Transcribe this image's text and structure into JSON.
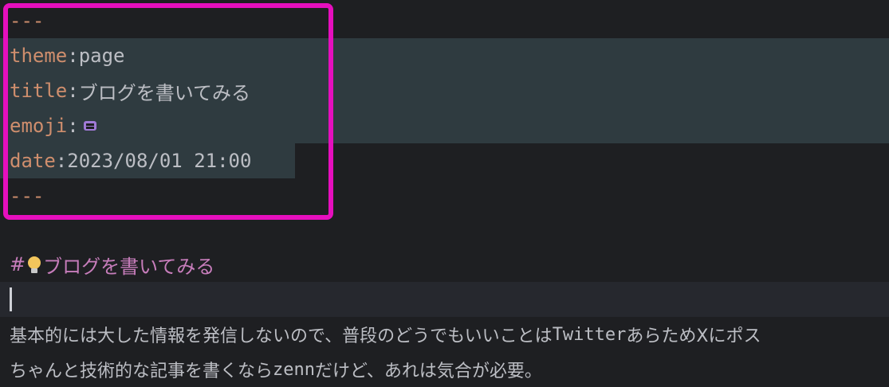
{
  "frontmatter": {
    "open_delim": "---",
    "theme_key": "theme",
    "theme_value": "page",
    "title_key": "title",
    "title_value": "ブログを書いてみる",
    "emoji_key": "emoji",
    "emoji_icon": "space-invader-icon",
    "date_key": "date",
    "date_value": "2023/08/01 21:00",
    "close_delim": "---"
  },
  "heading": {
    "marker": "#",
    "text": "ブログを書いてみる"
  },
  "body": {
    "line1_a": "基本的には大した情報を発信しないので、普段のどうでもいいことは",
    "line1_b": "Twitter",
    "line1_c": "あらためXにポス",
    "line2_a": "ちゃんと技術的な記事を書くなら",
    "line2_b": "zenn",
    "line2_c": "だけど、あれは気合が必要。"
  },
  "colors": {
    "highlight_border": "#e60fbe",
    "key": "#cf8e6d",
    "heading": "#c77dbb",
    "selection": "#2f3b40"
  }
}
